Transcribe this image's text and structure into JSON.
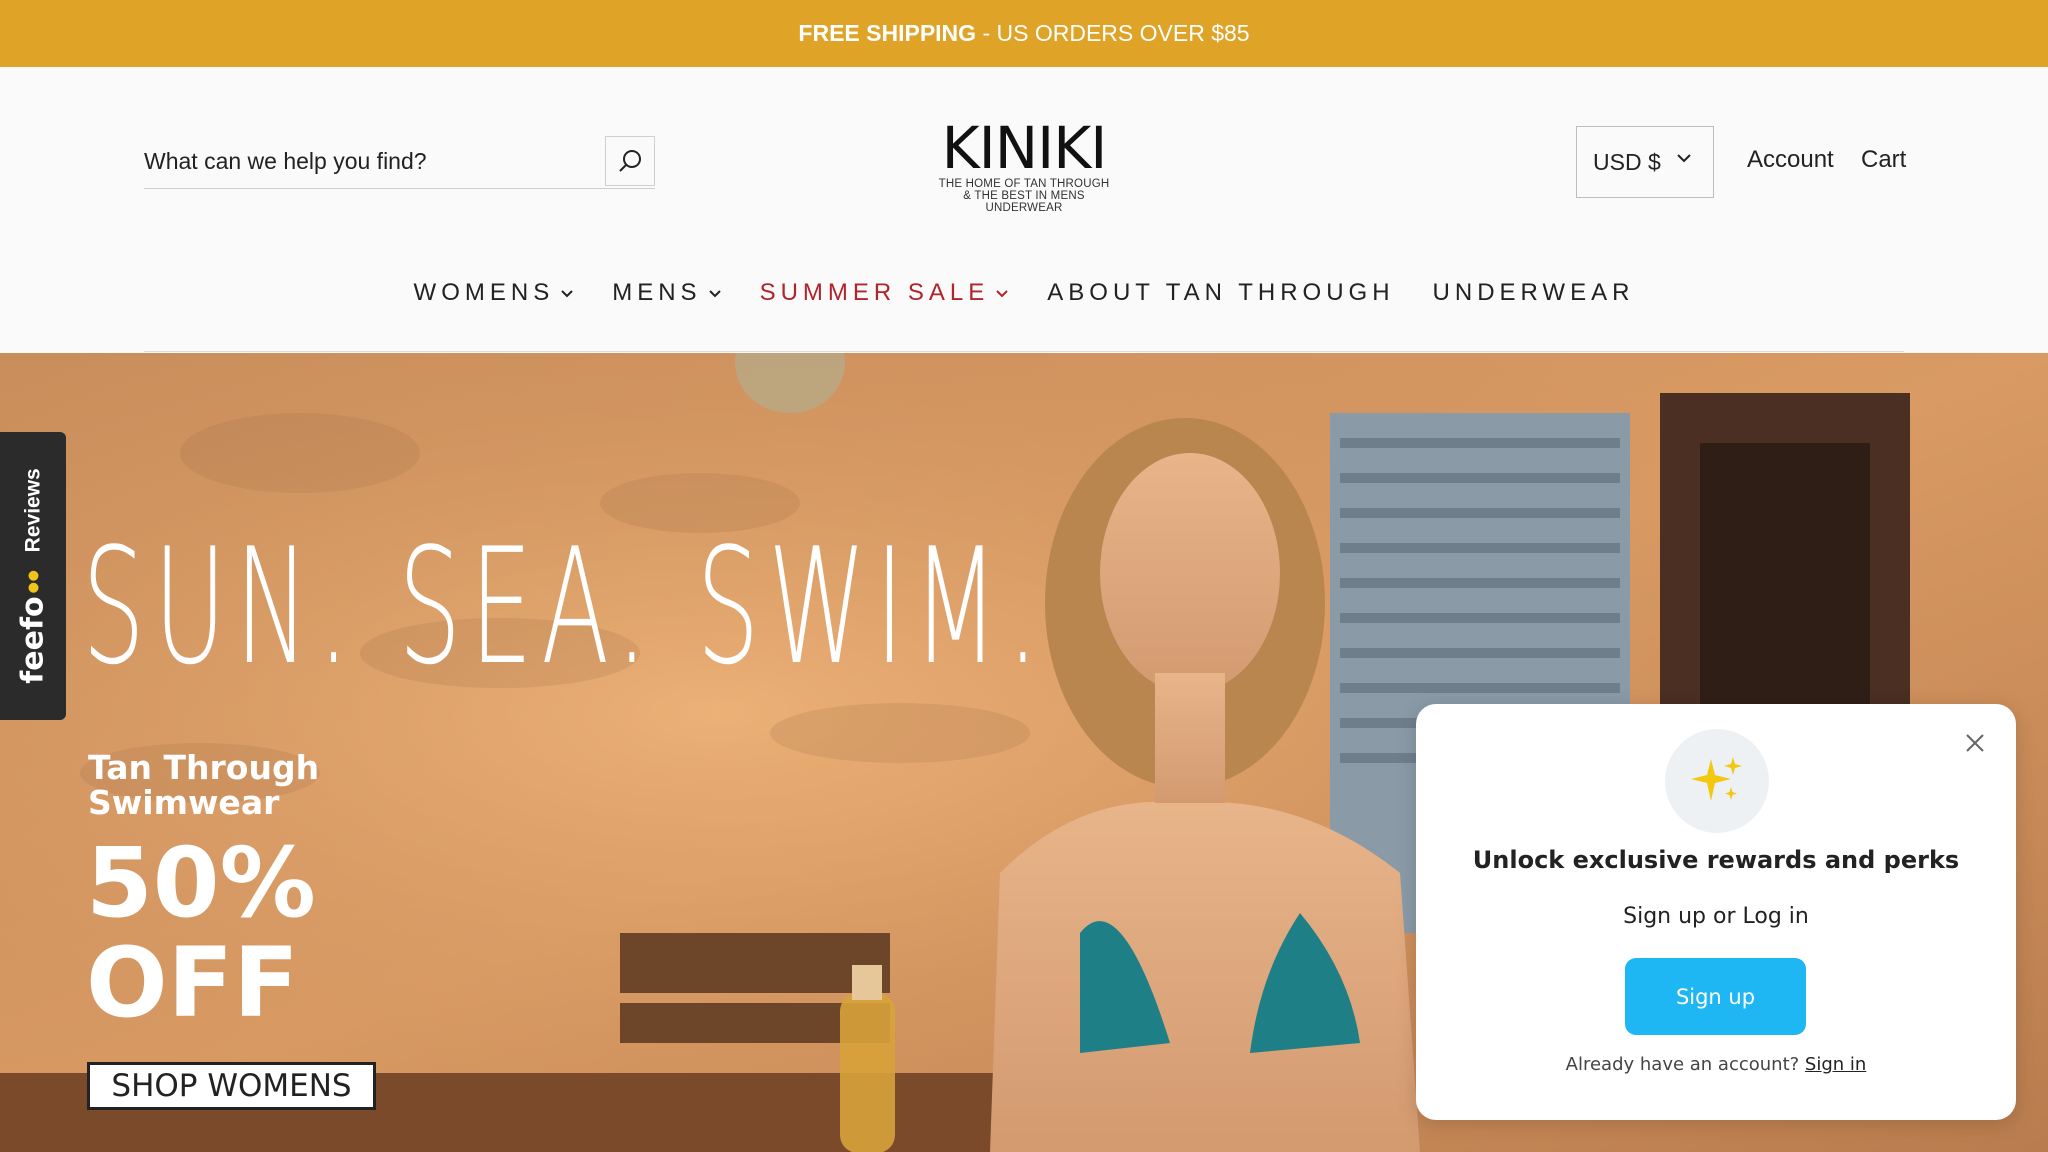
{
  "announcement": {
    "bold": "FREE SHIPPING",
    "rest": " - US ORDERS OVER $85"
  },
  "search": {
    "placeholder": "What can we help you find?",
    "icon": "search-icon"
  },
  "logo": {
    "word": "KINIKI",
    "tagline_1": "THE HOME OF TAN THROUGH",
    "tagline_2": "& THE BEST IN MENS UNDERWEAR"
  },
  "header": {
    "currency": "USD $",
    "account": "Account",
    "cart": "Cart"
  },
  "nav": {
    "items": [
      {
        "label": "WOMENS",
        "has_dropdown": true
      },
      {
        "label": "MENS",
        "has_dropdown": true
      },
      {
        "label": "SUMMER SALE",
        "has_dropdown": true,
        "color": "#B0242B"
      },
      {
        "label": "ABOUT TAN THROUGH",
        "has_dropdown": false
      },
      {
        "label": "UNDERWEAR",
        "has_dropdown": false
      }
    ]
  },
  "hero": {
    "headline": "SUN. SEA. SWIM.",
    "subtitle_1": "Tan Through",
    "subtitle_2": "Swimwear",
    "discount_1": "50%",
    "discount_2": "OFF",
    "cta": "SHOP WOMENS"
  },
  "reviews_tab": {
    "brand": "feefo",
    "label": "Reviews"
  },
  "rewards_popup": {
    "icon": "sparkles-icon",
    "title": "Unlock exclusive rewards and perks",
    "subtitle": "Sign up or Log in",
    "signup_button": "Sign up",
    "footer_text": "Already have an account? ",
    "signin_link": "Sign in"
  },
  "colors": {
    "announcement_bg": "#DFA327",
    "sale": "#B0242B",
    "signup_button": "#1EB7F3"
  }
}
